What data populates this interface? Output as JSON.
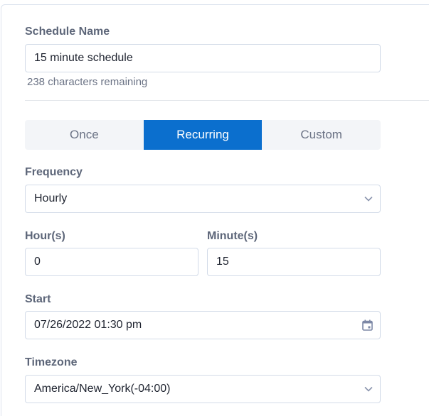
{
  "schedule_name": {
    "label": "Schedule Name",
    "value": "15 minute schedule",
    "helper": "238 characters remaining"
  },
  "mode_tabs": [
    {
      "label": "Once",
      "active": false
    },
    {
      "label": "Recurring",
      "active": true
    },
    {
      "label": "Custom",
      "active": false
    }
  ],
  "frequency": {
    "label": "Frequency",
    "value": "Hourly"
  },
  "hours": {
    "label": "Hour(s)",
    "value": "0"
  },
  "minutes": {
    "label": "Minute(s)",
    "value": "15"
  },
  "start": {
    "label": "Start",
    "value": "07/26/2022 01:30 pm"
  },
  "timezone": {
    "label": "Timezone",
    "value": "America/New_York(-04:00)"
  },
  "colors": {
    "accent": "#0b6fce"
  }
}
